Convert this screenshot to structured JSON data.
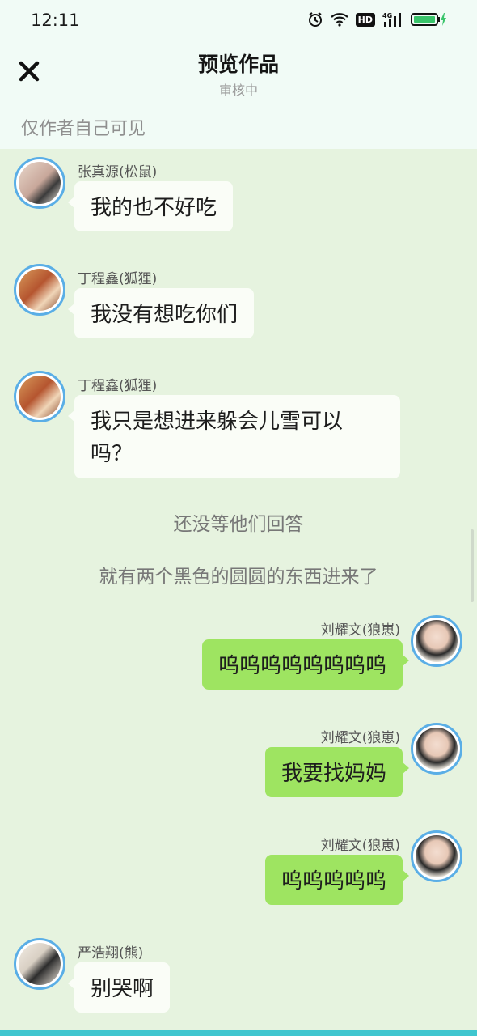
{
  "status_bar": {
    "time": "12:11",
    "hd": "HD",
    "network": "4G"
  },
  "header": {
    "title": "预览作品",
    "subtitle": "审核中",
    "close_icon": "close-icon"
  },
  "visibility_note": "仅作者自己可见",
  "messages": [
    {
      "side": "left",
      "sender": "张真源(松鼠)",
      "text": "我的也不好吃"
    },
    {
      "side": "left",
      "sender": "丁程鑫(狐狸)",
      "text": "我没有想吃你们"
    },
    {
      "side": "left",
      "sender": "丁程鑫(狐狸)",
      "text": "我只是想进来躲会儿雪可以吗？"
    },
    {
      "side": "right",
      "sender": "刘耀文(狼崽)",
      "text": "呜呜呜呜呜呜呜呜"
    },
    {
      "side": "right",
      "sender": "刘耀文(狼崽)",
      "text": "我要找妈妈"
    },
    {
      "side": "right",
      "sender": "刘耀文(狼崽)",
      "text": "呜呜呜呜呜"
    },
    {
      "side": "left",
      "sender": "严浩翔(熊)",
      "text": "别哭啊"
    }
  ],
  "narrations": [
    "还没等他们回答",
    "就有两个黑色的圆圆的东西进来了"
  ],
  "colors": {
    "chat_bg": "#e6f3df",
    "right_bubble": "#9ee461",
    "left_bubble": "#fafdf7",
    "avatar_ring": "#5aaee6"
  }
}
